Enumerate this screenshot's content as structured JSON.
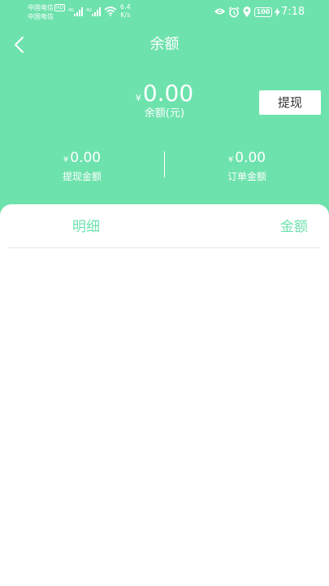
{
  "status_bar": {
    "carrier_1": "中国电信",
    "carrier_hd": "HD",
    "carrier_2": "中国电信",
    "net_speed_value": "6.4",
    "net_speed_unit": "K/s",
    "battery": "100",
    "time": "7:18"
  },
  "nav": {
    "title": "余额"
  },
  "balance": {
    "currency": "¥",
    "value": "0.00",
    "label": "余额(元)",
    "withdraw_button": "提现"
  },
  "stats": [
    {
      "currency": "¥",
      "value": "0.00",
      "label": "提现金额"
    },
    {
      "currency": "¥",
      "value": "0.00",
      "label": "订单金额"
    }
  ],
  "table": {
    "columns": [
      "明细",
      "金额"
    ],
    "rows": []
  },
  "colors": {
    "accent": "#6ee2ad",
    "surface": "#ffffff",
    "divider": "#e6e6e6"
  }
}
